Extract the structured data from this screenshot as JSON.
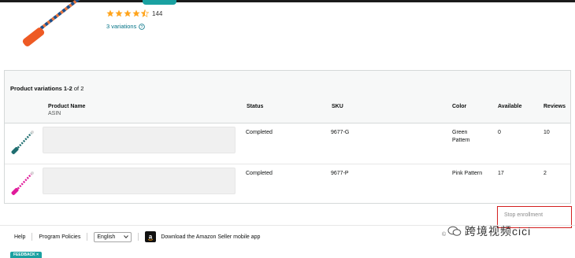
{
  "product": {
    "rating_stars": 4.5,
    "rating_count": "144",
    "variations_link": "3 variations"
  },
  "table": {
    "title_prefix": "Product variations 1-2",
    "title_suffix": "of 2",
    "headers": {
      "product_name": "Product Name",
      "asin": "ASIN",
      "status": "Status",
      "sku": "SKU",
      "color": "Color",
      "available": "Available",
      "reviews": "Reviews"
    },
    "rows": [
      {
        "status": "Completed",
        "sku": "9677-G",
        "color_line1": "Green",
        "color_line2": "Pattern",
        "available": "0",
        "reviews": "10",
        "accent": "#1f6e70"
      },
      {
        "status": "Completed",
        "sku": "9677-P",
        "color_line1": "Pink Pattern",
        "color_line2": "",
        "available": "17",
        "reviews": "2",
        "accent": "#e01a9a"
      }
    ]
  },
  "actions": {
    "stop_enrollment": "Stop enrollment"
  },
  "footer": {
    "help": "Help",
    "program_policies": "Program Policies",
    "language": "English",
    "app_link": "Download the Amazon Seller mobile app",
    "copyright": "©",
    "watermark": "跨境视频cici",
    "feedback": "FEEDBACK ×"
  },
  "colors": {
    "star": "#ffa41c",
    "link": "#007185",
    "highlight_box": "#d32020",
    "feedback_bg": "#1aa1a1"
  }
}
